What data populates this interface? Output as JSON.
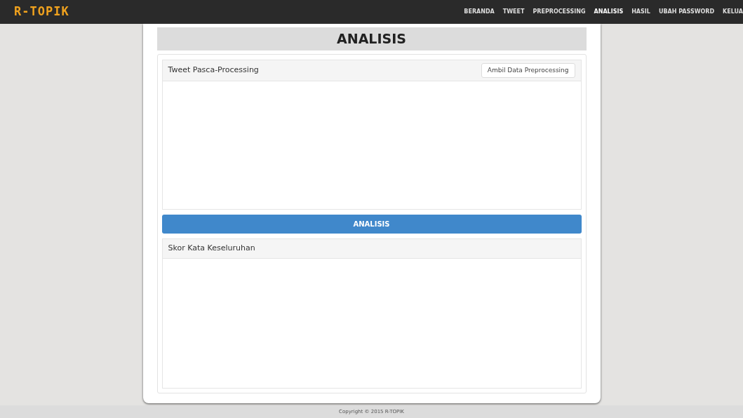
{
  "brand": "R-TOPIK",
  "nav": [
    {
      "label": "BERANDA",
      "selected": false
    },
    {
      "label": "TWEET",
      "selected": false
    },
    {
      "label": "PREPROCESSING",
      "selected": false
    },
    {
      "label": "ANALISIS",
      "selected": true
    },
    {
      "label": "HASIL",
      "selected": false
    },
    {
      "label": "UBAH PASSWORD",
      "selected": false
    },
    {
      "label": "KELUA",
      "selected": false
    }
  ],
  "page_title": "ANALISIS",
  "panels": [
    {
      "title": "Tweet Pasca-Processing",
      "button": "Ambil Data Preprocessing"
    },
    {
      "title": "Skor Kata Keseluruhan"
    }
  ],
  "action_button": "ANALISIS",
  "footer": "Copyright © 2015 R-TOPIK"
}
